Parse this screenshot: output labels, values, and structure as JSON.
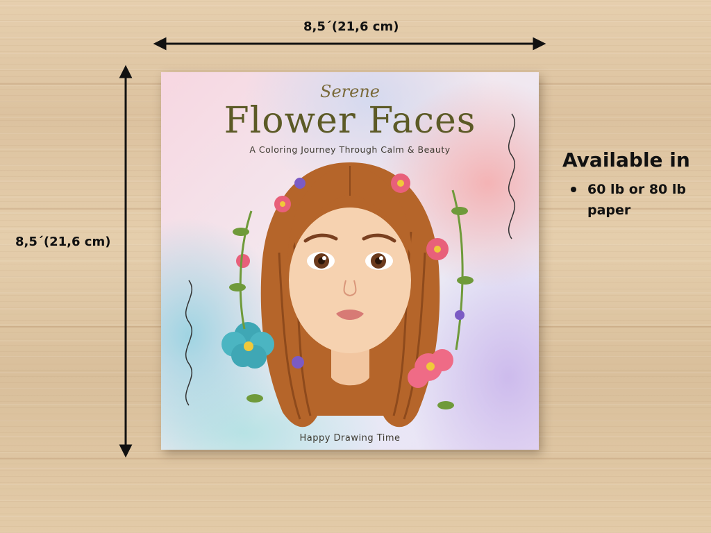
{
  "dimensions": {
    "width_label": "8,5´(21,6 cm)",
    "height_label": "8,5´(21,6 cm)"
  },
  "availability": {
    "heading": "Available in",
    "items": [
      "60 lb or 80 lb paper"
    ]
  },
  "cover": {
    "script_title": "Serene",
    "title": "Flower Faces",
    "subtitle": "A Coloring Journey Through Calm & Beauty",
    "footer": "Happy Drawing Time"
  },
  "colors": {
    "wood": "#e0c8a5",
    "hair": "#b5652a",
    "title_olive": "#5c5a26",
    "flower_pink": "#e8607a",
    "flower_teal": "#3fa7b5",
    "flower_purple": "#7b5bc4",
    "leaf_green": "#6f9a3a"
  }
}
